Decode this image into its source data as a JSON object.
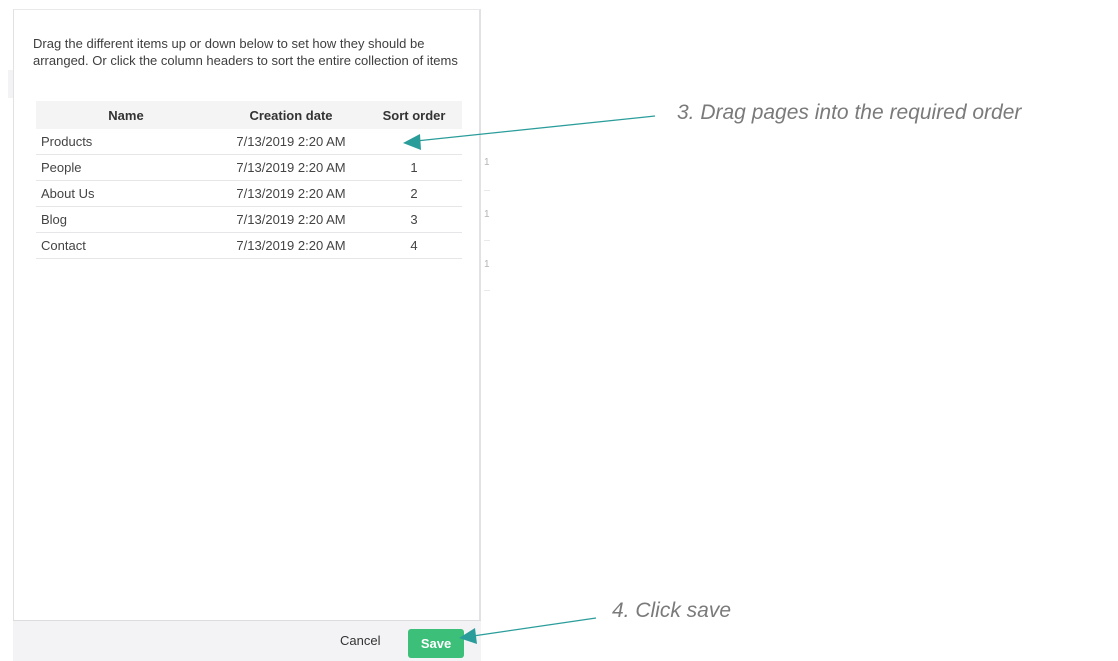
{
  "dialog": {
    "intro_text": "Drag the different items up or down below to set how they should be arranged. Or click the column headers to sort the entire collection of items",
    "columns": {
      "name": "Name",
      "creation_date": "Creation date",
      "sort_order": "Sort order"
    },
    "rows": [
      {
        "name": "Products",
        "creation_date": "7/13/2019 2:20 AM",
        "sort_order": ""
      },
      {
        "name": "People",
        "creation_date": "7/13/2019 2:20 AM",
        "sort_order": "1"
      },
      {
        "name": "About Us",
        "creation_date": "7/13/2019 2:20 AM",
        "sort_order": "2"
      },
      {
        "name": "Blog",
        "creation_date": "7/13/2019 2:20 AM",
        "sort_order": "3"
      },
      {
        "name": "Contact",
        "creation_date": "7/13/2019 2:20 AM",
        "sort_order": "4"
      }
    ],
    "footer": {
      "cancel_label": "Cancel",
      "save_label": "Save"
    }
  },
  "annotations": {
    "step3": "3. Drag pages into the required order",
    "step4": "4. Click save"
  },
  "background_glyphs": [
    "1",
    "1",
    "1"
  ],
  "colors": {
    "save_button": "#3cbf78",
    "arrow": "#2a9d9a",
    "annotation_text": "#7a7a7a"
  }
}
